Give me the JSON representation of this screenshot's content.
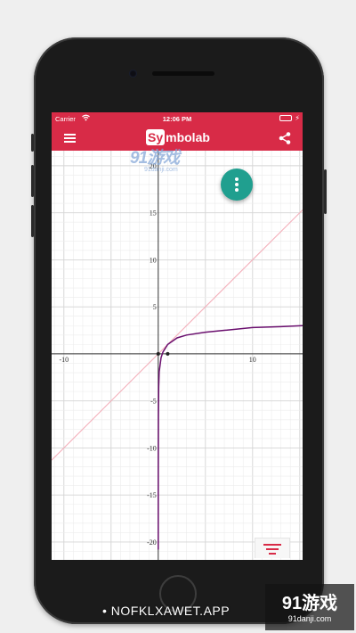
{
  "status_bar": {
    "carrier": "Carrier",
    "wifi_icon": "wifi-icon",
    "time": "12:06 PM",
    "battery_icon": "battery-icon",
    "battery_color": "#7ee36a"
  },
  "app_bar": {
    "logo_box": "Sy",
    "logo_rest": "mbolab",
    "menu_icon": "hamburger-menu-icon",
    "share_icon": "share-icon",
    "color": "#d82b47"
  },
  "fab": {
    "icon": "more-vertical-icon",
    "color": "#209f8f"
  },
  "sort_button": {
    "icon": "filter-list-icon"
  },
  "watermark": {
    "main": "91游戏",
    "sub": "91danji.com"
  },
  "overlay": {
    "caption": "• NOFKLXAWET.APP",
    "brand_main": "91游戏",
    "brand_sub": "91danji.com"
  },
  "chart_data": {
    "type": "line",
    "xlim": [
      -11.3,
      15.3
    ],
    "ylim": [
      -21.9,
      21.6
    ],
    "grid": true,
    "x_tick_labels": [
      "-10",
      "10"
    ],
    "y_tick_labels": [
      "20",
      "15",
      "10",
      "5",
      "-5",
      "-10",
      "-15",
      "-20"
    ],
    "series": [
      {
        "color": "#f4b0bb",
        "x": [
          -11.3,
          15.3
        ],
        "y": [
          -11.3,
          15.3
        ]
      },
      {
        "color": "#6a0f6e",
        "x": [
          0.001,
          0.005,
          0.02,
          0.05,
          0.1,
          0.3,
          0.5,
          1,
          2,
          3,
          5,
          7,
          10,
          13,
          15.3
        ],
        "y": [
          -20.8,
          -12.5,
          -6.6,
          -3.5,
          -1.9,
          -0.4,
          0.2,
          1.0,
          1.7,
          2.0,
          2.3,
          2.5,
          2.8,
          2.9,
          3.0
        ]
      }
    ],
    "points": [
      {
        "x": 0,
        "y": 0
      },
      {
        "x": 1,
        "y": 0
      }
    ]
  }
}
